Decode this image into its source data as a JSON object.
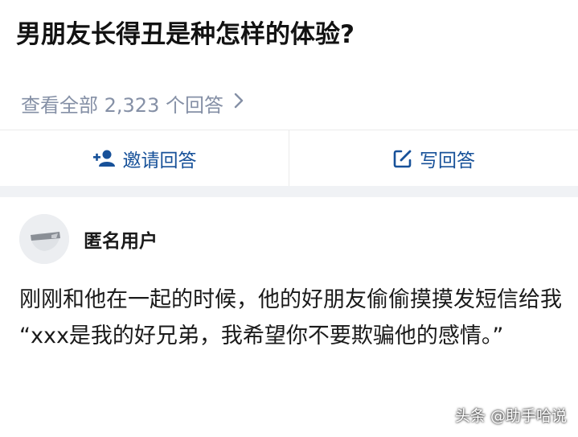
{
  "question": {
    "title": "男朋友长得丑是种怎样的体验?",
    "view_all": "查看全部 2,323 个回答"
  },
  "actions": {
    "invite_label": "邀请回答",
    "write_label": "写回答"
  },
  "answer": {
    "author": "匿名用户",
    "paragraphs": [
      "刚刚和他在一起的时候，他的好朋友偷偷摸摸发短信给我",
      "“xxx是我的好兄弟，我希望你不要欺骗他的感情。”"
    ]
  },
  "watermark": "头条 @助手哈说",
  "colors": {
    "link_blue": "#175199",
    "muted_gray": "#8590a6",
    "divider": "#f0f2f5"
  },
  "icons": {
    "view_all": "chevron-right-icon",
    "invite": "add-user-icon",
    "write": "edit-icon",
    "avatar": "anonymous-avatar-icon"
  }
}
